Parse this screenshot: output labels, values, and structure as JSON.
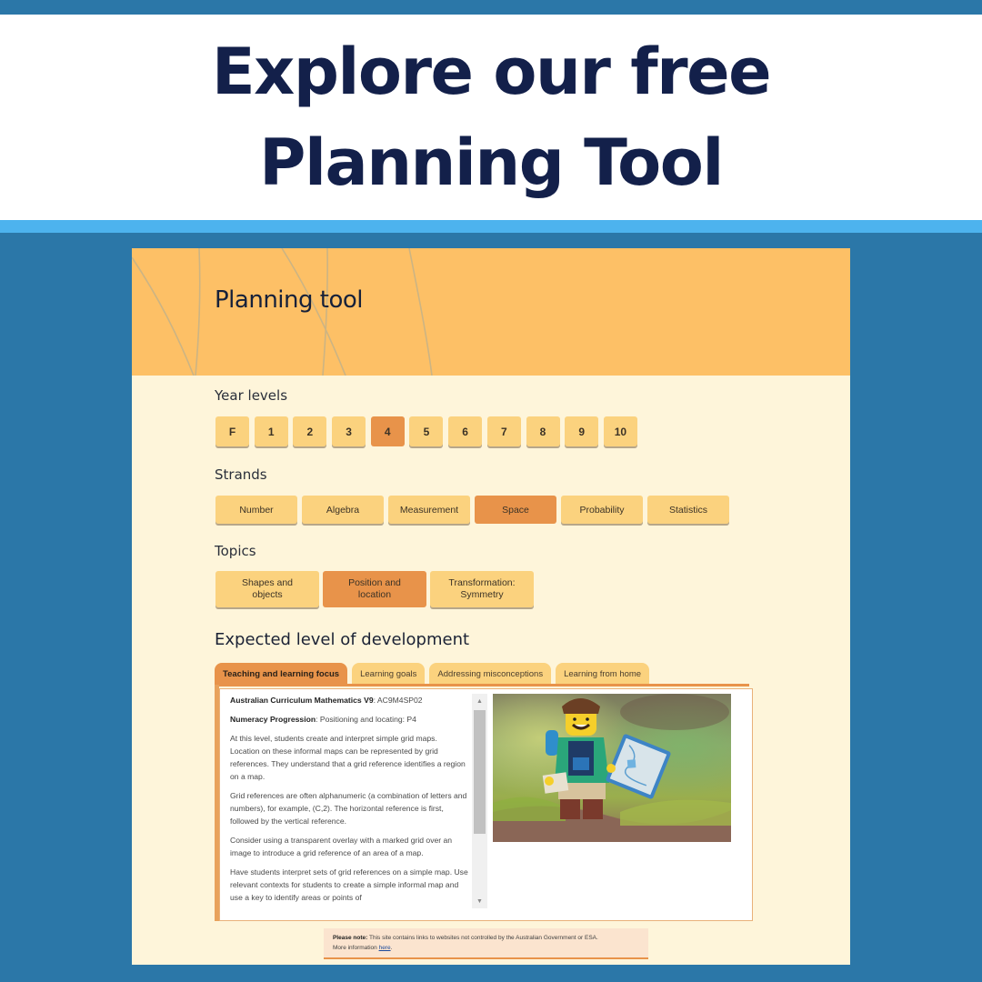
{
  "banner": {
    "line1": "Explore our free",
    "line2": "Planning Tool"
  },
  "colors": {
    "background": "#2b77a8",
    "stripe": "#4db3ee",
    "header": "#fdc066",
    "panel": "#fef5da",
    "button": "#fbd27e",
    "selected": "#e8934a",
    "title_text": "#13204a"
  },
  "page": {
    "title": "Planning tool"
  },
  "year_levels": {
    "label": "Year levels",
    "selected": "4",
    "items": [
      {
        "label": "F"
      },
      {
        "label": "1"
      },
      {
        "label": "2"
      },
      {
        "label": "3"
      },
      {
        "label": "4",
        "active": true
      },
      {
        "label": "5"
      },
      {
        "label": "6"
      },
      {
        "label": "7"
      },
      {
        "label": "8"
      },
      {
        "label": "9"
      },
      {
        "label": "10"
      }
    ]
  },
  "strands": {
    "label": "Strands",
    "selected": "Space",
    "items": [
      {
        "label": "Number"
      },
      {
        "label": "Algebra"
      },
      {
        "label": "Measurement"
      },
      {
        "label": "Space",
        "active": true
      },
      {
        "label": "Probability"
      },
      {
        "label": "Statistics"
      }
    ]
  },
  "topics": {
    "label": "Topics",
    "selected": "Position and location",
    "items": [
      {
        "line1": "Shapes and",
        "line2": "objects"
      },
      {
        "line1": "Position and",
        "line2": "location",
        "active": true
      },
      {
        "line1": "Transformation:",
        "line2": "Symmetry"
      }
    ]
  },
  "expected_level": {
    "title": "Expected level of development",
    "tabs": [
      {
        "label": "Teaching and learning focus",
        "active": true
      },
      {
        "label": "Learning goals"
      },
      {
        "label": "Addressing misconceptions"
      },
      {
        "label": "Learning from home"
      }
    ],
    "content": {
      "curriculum_label": "Australian Curriculum Mathematics V9",
      "curriculum_code": ": AC9M4SP02",
      "progression_label": "Numeracy Progression",
      "progression_value": ": Positioning and locating: P4",
      "paragraphs": [
        "At this level, students create and interpret simple grid maps. Location on these informal maps can be represented by grid references. They understand that a grid reference identifies a region on a map.",
        "Grid references are often alphanumeric (a combination of letters and numbers), for example, (C,2). The horizontal reference is first, followed by the vertical reference.",
        "Consider using a transparent overlay with a marked grid over an image to introduce a grid reference of an area of a map.",
        "Have students interpret sets of grid references on a simple map. Use relevant contexts for students to create a simple informal map and use a key to identify areas or points of"
      ],
      "image_alt": "Lego minifigure hiker holding a map outdoors"
    }
  },
  "note": {
    "bold": "Please note:",
    "text": " This site contains links to websites not controlled by the Australian Government or ESA.",
    "more": "More information ",
    "link": "here",
    "end": "."
  }
}
